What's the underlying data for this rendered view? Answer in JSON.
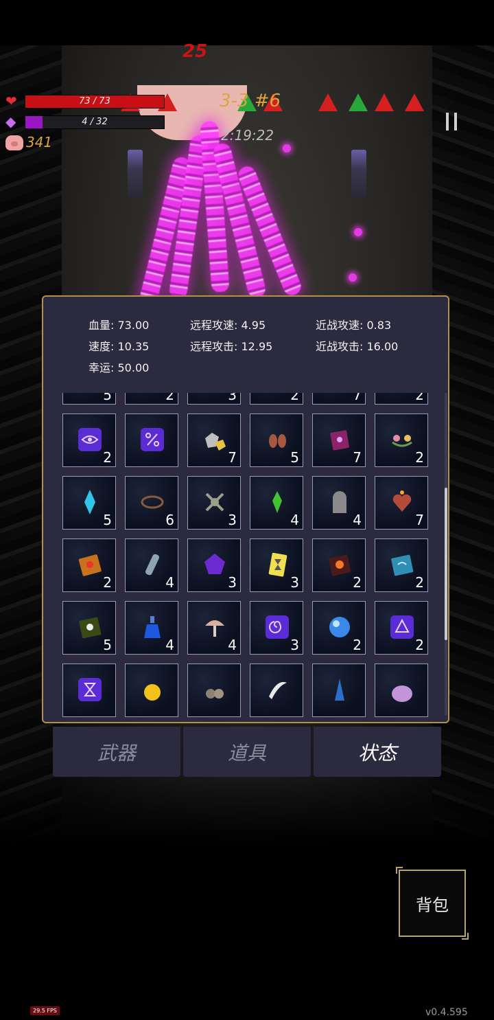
{
  "hud": {
    "hp_text": "73 / 73",
    "hp_fraction": 1.0,
    "mp_text": "4 / 32",
    "mp_fraction": 0.125,
    "gold": "341",
    "stage": "3-3 #6",
    "timer": "2:19:22",
    "boss_damage": "25"
  },
  "stats": {
    "hp_label": "血量:",
    "hp_value": "73.00",
    "ranged_speed_label": "远程攻速:",
    "ranged_speed_value": "4.95",
    "melee_speed_label": "近战攻速:",
    "melee_speed_value": "0.83",
    "speed_label": "速度:",
    "speed_value": "10.35",
    "ranged_attack_label": "远程攻击:",
    "ranged_attack_value": "12.95",
    "melee_attack_label": "近战攻击:",
    "melee_attack_value": "16.00",
    "luck_label": "幸运:",
    "luck_value": "50.00"
  },
  "items": [
    {
      "icon": "egg-icon",
      "count": "5"
    },
    {
      "icon": "plus-rune-icon",
      "count": "2"
    },
    {
      "icon": "purple-rune-icon",
      "count": "3"
    },
    {
      "icon": "magnifier-icon",
      "count": "2"
    },
    {
      "icon": "horseshoe-icon",
      "count": "7"
    },
    {
      "icon": "candle-icon",
      "count": "2"
    },
    {
      "icon": "eye-rune-icon",
      "count": "2"
    },
    {
      "icon": "percent-rune-icon",
      "count": ""
    },
    {
      "icon": "gold-ore-icon",
      "count": "7"
    },
    {
      "icon": "gloves-icon",
      "count": "5"
    },
    {
      "icon": "spellbook-purple-icon",
      "count": "7"
    },
    {
      "icon": "flower-crown-icon",
      "count": "2"
    },
    {
      "icon": "blue-crystal-icon",
      "count": "5"
    },
    {
      "icon": "thorn-crown-icon",
      "count": "6"
    },
    {
      "icon": "tentacle-icon",
      "count": "3"
    },
    {
      "icon": "green-gem-icon",
      "count": "4"
    },
    {
      "icon": "tombstone-icon",
      "count": "4"
    },
    {
      "icon": "burning-heart-icon",
      "count": "7"
    },
    {
      "icon": "fire-book-icon",
      "count": "2"
    },
    {
      "icon": "potion-vial-icon",
      "count": "4"
    },
    {
      "icon": "purple-pentagon-gem-icon",
      "count": "3"
    },
    {
      "icon": "hourglass-card-icon",
      "count": "3"
    },
    {
      "icon": "skull-book-icon",
      "count": "2"
    },
    {
      "icon": "blue-tome-icon",
      "count": "2"
    },
    {
      "icon": "green-skull-book-icon",
      "count": "5"
    },
    {
      "icon": "blue-potion-icon",
      "count": "4"
    },
    {
      "icon": "mushroom-icon",
      "count": "4"
    },
    {
      "icon": "spiral-rune-icon",
      "count": "3"
    },
    {
      "icon": "crystal-ball-icon",
      "count": "2"
    },
    {
      "icon": "triangle-rune-icon",
      "count": "2"
    },
    {
      "icon": "hourglass-rune-icon",
      "count": ""
    },
    {
      "icon": "gold-orb-icon",
      "count": ""
    },
    {
      "icon": "rock-pile-icon",
      "count": ""
    },
    {
      "icon": "claw-icon",
      "count": ""
    },
    {
      "icon": "blue-spike-icon",
      "count": ""
    },
    {
      "icon": "purple-slime-icon",
      "count": ""
    }
  ],
  "tabs": {
    "weapons": "武器",
    "items": "道具",
    "status": "状态"
  },
  "bag_label": "背包",
  "fps": "29.5 FPS",
  "version": "v0.4.595",
  "colors": {
    "hp": "#c90f16",
    "mp": "#9a16c4",
    "gold_text": "#d9a63c",
    "panel_bg": "#2b2a3f",
    "panel_border": "#b58f4a",
    "beam": "#ff3cff"
  }
}
